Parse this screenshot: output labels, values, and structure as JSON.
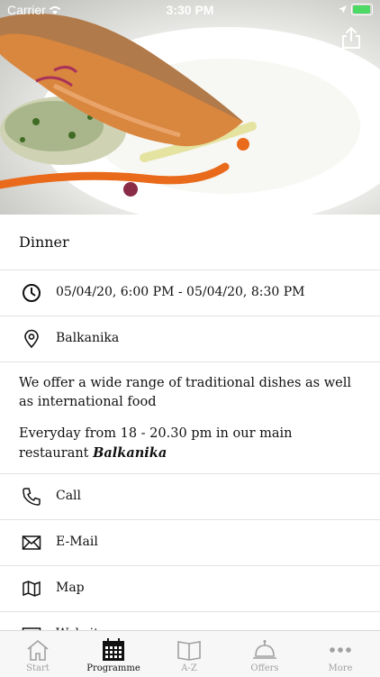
{
  "status_bar": {
    "carrier": "Carrier",
    "time": "3:30 PM"
  },
  "event": {
    "title": "Dinner",
    "datetime": "05/04/20, 6:00 PM - 05/04/20, 8:30 PM",
    "location": "Balkanika",
    "description_1": "We offer a wide range of traditional dishes as well as international food",
    "description_2_prefix": "Everyday from 18 - 20.30 pm in our main restaurant",
    "description_2_emphasis": "Balkanika"
  },
  "actions": [
    {
      "label": "Call",
      "icon": "phone-icon"
    },
    {
      "label": "E-Mail",
      "icon": "mail-icon"
    },
    {
      "label": "Map",
      "icon": "map-icon"
    },
    {
      "label": "Website",
      "icon": "website-icon"
    }
  ],
  "tabs": [
    {
      "label": "Start",
      "icon": "home-icon",
      "active": false
    },
    {
      "label": "Programme",
      "icon": "calendar-icon",
      "active": true
    },
    {
      "label": "A-Z",
      "icon": "book-icon",
      "active": false
    },
    {
      "label": "Offers",
      "icon": "bell-icon",
      "active": false
    },
    {
      "label": "More",
      "icon": "more-icon",
      "active": false
    }
  ],
  "colors": {
    "battery": "#4cd964",
    "tab_inactive": "#a0a0a0",
    "tab_active": "#111111"
  }
}
